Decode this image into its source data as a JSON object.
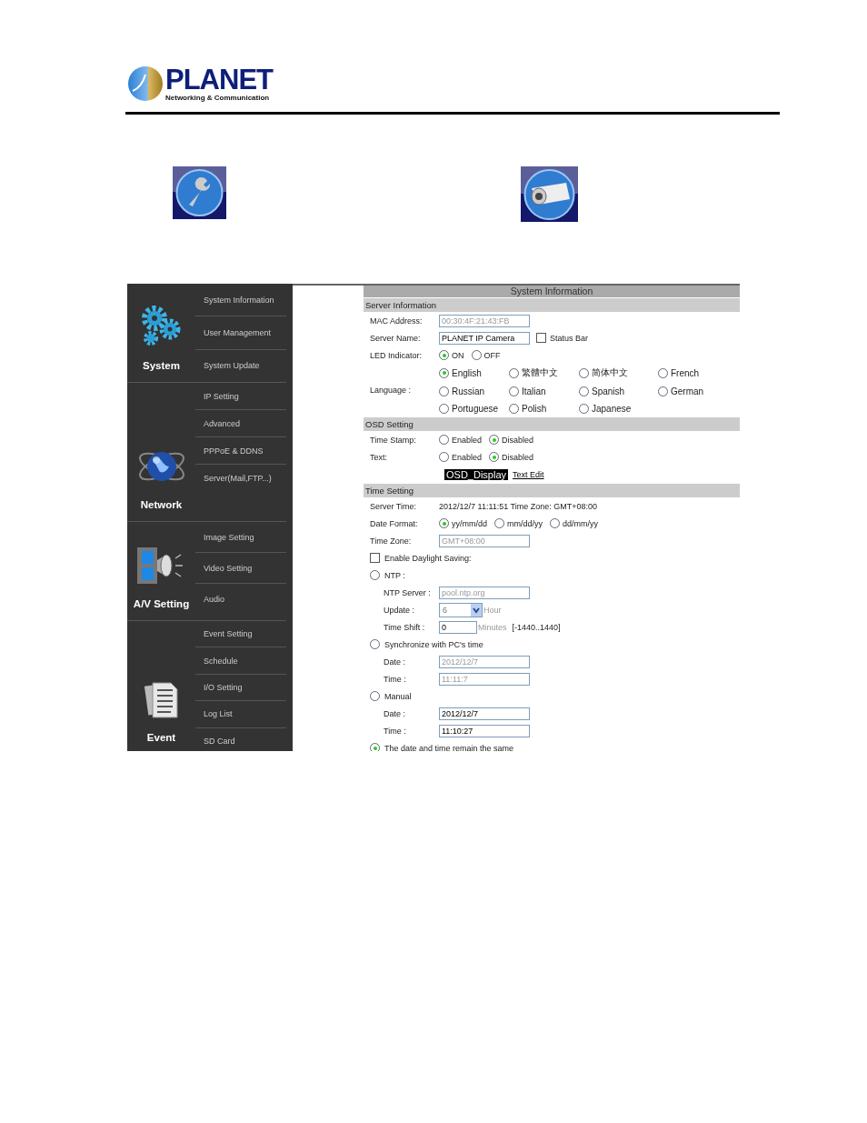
{
  "header": {
    "brand": "PLANET",
    "tagline": "Networking & Communication"
  },
  "sidebar": [
    {
      "title": "System",
      "kind": "gears",
      "items": [
        "System Information",
        "User Management",
        "System Update"
      ]
    },
    {
      "title": "Network",
      "kind": "globe",
      "items": [
        "IP Setting",
        "Advanced",
        "PPPoE & DDNS",
        "Server(Mail,FTP...)"
      ]
    },
    {
      "title": "A/V Setting",
      "kind": "media",
      "items": [
        "Image Setting",
        "Video Setting",
        "Audio"
      ]
    },
    {
      "title": "Event",
      "kind": "documents",
      "items": [
        "Event Setting",
        "Schedule",
        "I/O Setting",
        "Log List",
        "SD Card"
      ]
    }
  ],
  "panel": {
    "title": "System Information",
    "sections": [
      {
        "heading": "Server Information",
        "rows": [
          {
            "kind": "field",
            "label": "MAC Address:",
            "value": "00:30:4F:21:43:FB",
            "disabled": true
          },
          {
            "kind": "field",
            "label": "Server Name:",
            "value": "PLANET IP Camera",
            "disabled": false,
            "checkbox": {
              "label": "Status Bar",
              "checked": false
            }
          },
          {
            "kind": "radios",
            "label": "LED Indicator:",
            "options": [
              {
                "label": "ON",
                "selected": true
              },
              {
                "label": "OFF",
                "selected": false
              }
            ]
          },
          {
            "kind": "radio_grid",
            "label": "Language :",
            "lines": [
              [
                {
                  "label": "English",
                  "selected": true
                },
                {
                  "label": "繁體中文",
                  "selected": false
                },
                {
                  "label": "简体中文",
                  "selected": false
                },
                {
                  "label": "French",
                  "selected": false
                }
              ],
              [
                {
                  "label": "Russian",
                  "selected": false
                },
                {
                  "label": "Italian",
                  "selected": false
                },
                {
                  "label": "Spanish",
                  "selected": false
                },
                {
                  "label": "German",
                  "selected": false
                }
              ],
              [
                {
                  "label": "Portuguese",
                  "selected": false
                },
                {
                  "label": "Polish",
                  "selected": false
                },
                {
                  "label": "Japanese",
                  "selected": false
                }
              ]
            ]
          }
        ]
      },
      {
        "heading": "OSD Setting",
        "rows": [
          {
            "kind": "radios",
            "label": "Time Stamp:",
            "options": [
              {
                "label": "Enabled",
                "selected": false
              },
              {
                "label": "Disabled",
                "selected": true
              }
            ]
          },
          {
            "kind": "radios",
            "label": "Text:",
            "options": [
              {
                "label": "Enabled",
                "selected": false
              },
              {
                "label": "Disabled",
                "selected": true
              }
            ]
          },
          {
            "kind": "osd",
            "display": "OSD_Display",
            "link": "Text Edit"
          }
        ]
      },
      {
        "heading": "Time Setting",
        "rows": [
          {
            "kind": "info",
            "label": "Server Time:",
            "value": "2012/12/7 11:11:51 Time Zone: GMT+08:00"
          },
          {
            "kind": "radios",
            "label": "Date Format:",
            "options": [
              {
                "label": "yy/mm/dd",
                "selected": true
              },
              {
                "label": "mm/dd/yy",
                "selected": false
              },
              {
                "label": "dd/mm/yy",
                "selected": false
              }
            ]
          },
          {
            "kind": "field",
            "label": "Time Zone:",
            "value": "GMT+08:00",
            "disabled": true
          },
          {
            "kind": "checkbox",
            "label": "Enable Daylight Saving:",
            "checked": false
          },
          {
            "kind": "radio",
            "label": "NTP :",
            "selected": false,
            "children": [
              {
                "kind": "field",
                "label": "NTP Server :",
                "value": "pool.ntp.org",
                "disabled": true
              },
              {
                "kind": "select",
                "label": "Update :",
                "value": "6",
                "suffix": "Hour"
              },
              {
                "kind": "number_field",
                "label": "Time Shift :",
                "value": "0",
                "suffix": "Minutes",
                "note": "[-1440..1440]"
              }
            ]
          },
          {
            "kind": "radio",
            "label": "Synchronize with PC's time",
            "selected": false,
            "children": [
              {
                "kind": "field",
                "label": "Date :",
                "value": "2012/12/7",
                "disabled": true
              },
              {
                "kind": "field",
                "label": "Time :",
                "value": "11:11:7",
                "disabled": true
              }
            ]
          },
          {
            "kind": "radio",
            "label": "Manual",
            "selected": false,
            "children": [
              {
                "kind": "field",
                "label": "Date :",
                "value": "2012/12/7",
                "disabled": false
              },
              {
                "kind": "field",
                "label": "Time :",
                "value": "11:10:27",
                "disabled": false
              }
            ]
          },
          {
            "kind": "radio",
            "label": "The date and time remain the same",
            "selected": true
          }
        ]
      }
    ]
  }
}
